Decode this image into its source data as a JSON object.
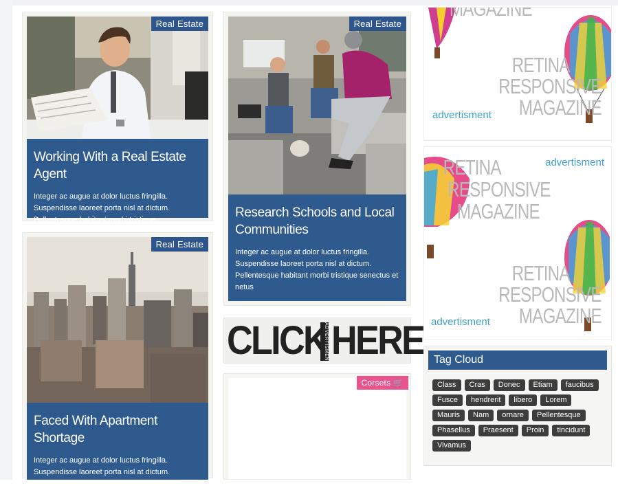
{
  "cards": [
    {
      "badge": "Real Estate",
      "title": "Working With a Real Estate Agent",
      "excerpt": "Integer ac augue at dolor luctus fringilla. Suspendisse laoreet porta nisl at dictum. Pellentesque habitant morbi tristique"
    },
    {
      "badge": "Real Estate",
      "title": "Research Schools and Local Communities",
      "excerpt": "Integer ac augue at dolor luctus fringilla. Suspendisse laoreet porta nisl at dictum. Pellentesque habitant morbi tristique senectus et netus"
    },
    {
      "badge": "Real Estate",
      "title": "Faced With Apartment Shortage",
      "excerpt": "Integer ac augue at dolor luctus fringilla. Suspendisse laoreet porta nisl at dictum. Pellentesque habitant morbi tristique senectus"
    }
  ],
  "corsets": {
    "badge": "Corsets",
    "icon": "cart-icon"
  },
  "click_banner": {
    "left": "CLICK",
    "side": "ADVERTISMENT",
    "right": "HERE"
  },
  "ads": [
    {
      "line1": "MAGAZINE",
      "line2": "RETINA",
      "line3": "RESPONSIVE",
      "line4": "MAGAZINE",
      "label": "advertisment"
    },
    {
      "line1": "RETINA",
      "line2": "RESPONSIVE",
      "line3": "MAGAZINE",
      "line4": "RETINA",
      "line5": "RESPONSIVE",
      "line6": "MAGAZINE",
      "label": "advertisment",
      "label2": "advertisment"
    }
  ],
  "tag_cloud": {
    "title": "Tag Cloud",
    "tags": [
      "Class",
      "Cras",
      "Donec",
      "Etiam",
      "faucibus",
      "Fusce",
      "hendrerit",
      "libero",
      "Lorem",
      "Mauris",
      "Nam",
      "ornare",
      "Pellentesque",
      "Phasellus",
      "Praesent",
      "Proin",
      "tincidunt",
      "Vivamus"
    ]
  },
  "colors": {
    "brand_blue": "#2e5a8e",
    "ad_label": "#3ea2c9",
    "pink_badge": "#e8558e",
    "tag_bg": "#3d3d3d"
  }
}
